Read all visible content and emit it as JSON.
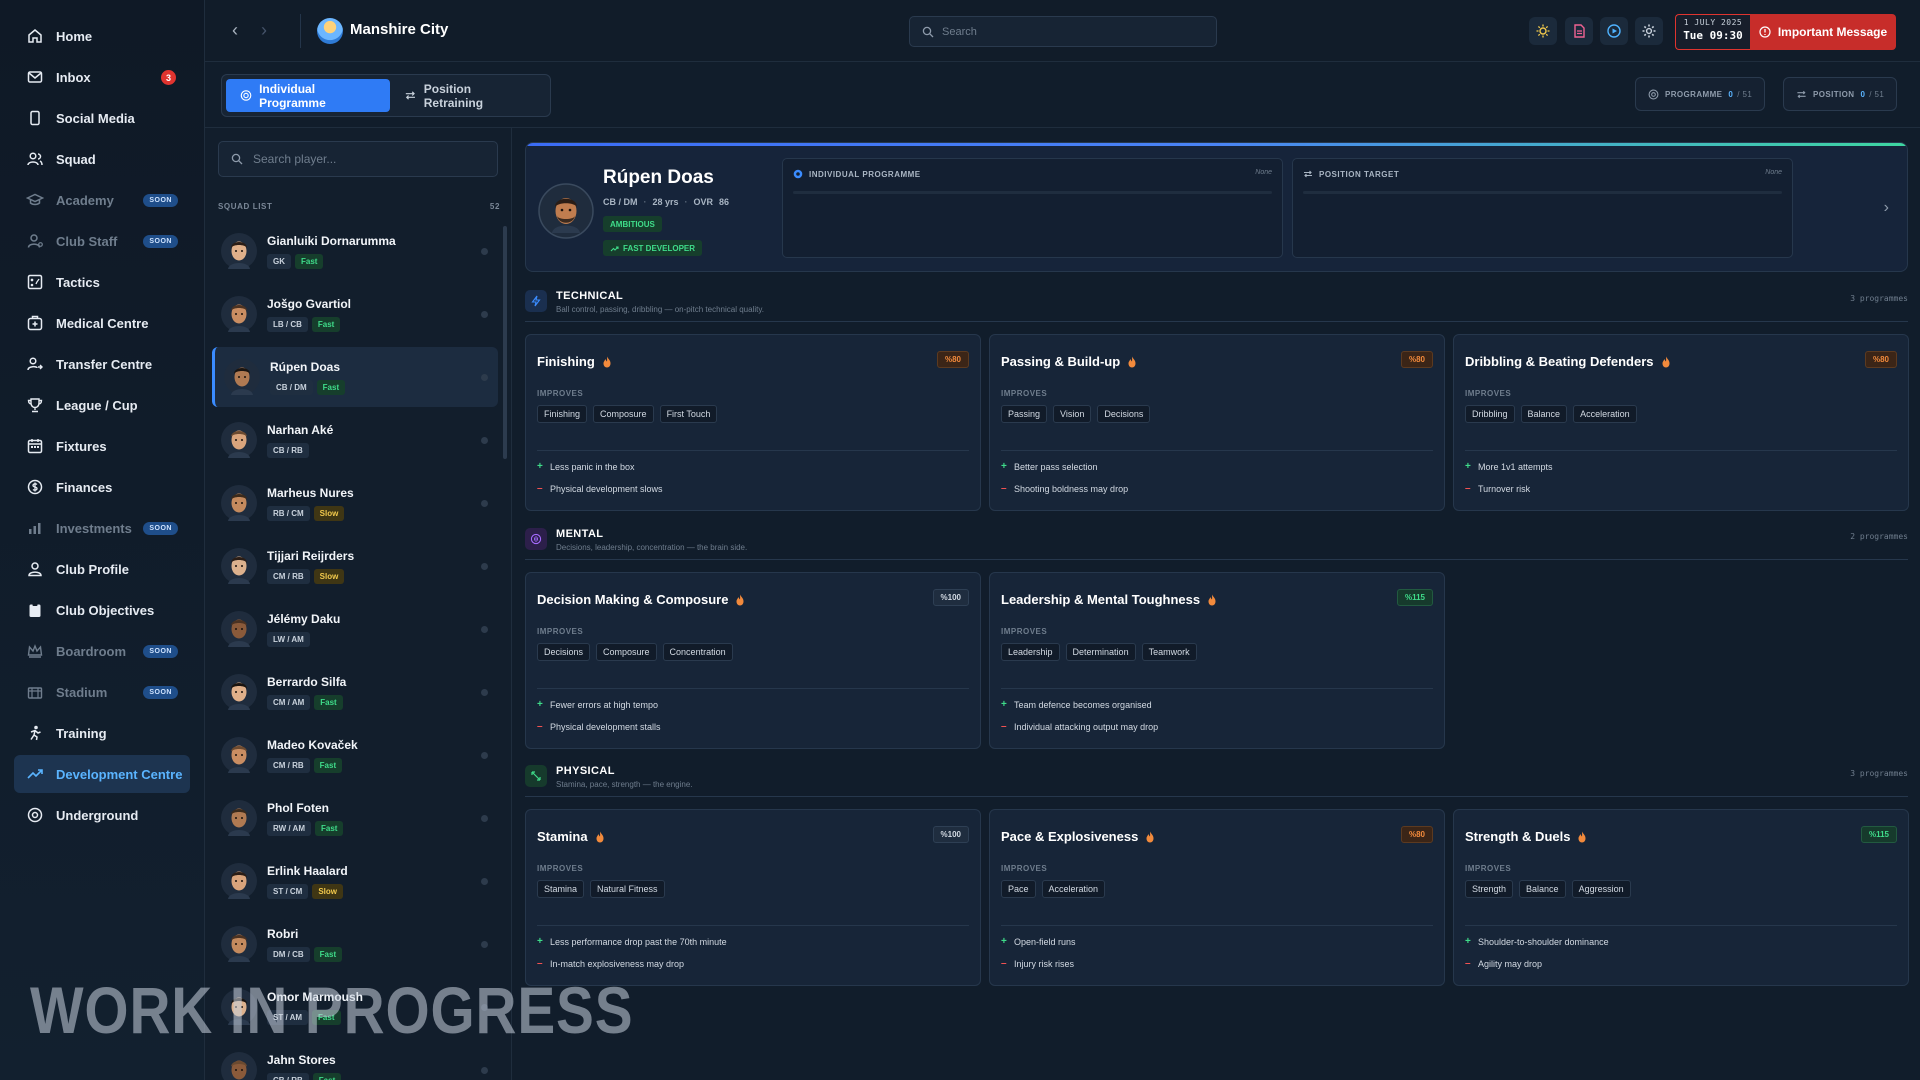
{
  "nav": [
    {
      "label": "Home",
      "icon": "home-icon"
    },
    {
      "label": "Inbox",
      "icon": "mail-icon",
      "badge": "3"
    },
    {
      "label": "Social Media",
      "icon": "phone-icon"
    },
    {
      "label": "Squad",
      "icon": "users-icon"
    },
    {
      "label": "Academy",
      "icon": "graduation-cap-icon",
      "soon": "SOON",
      "dim": true
    },
    {
      "label": "Club Staff",
      "icon": "staff-icon",
      "soon": "SOON",
      "dim": true
    },
    {
      "label": "Tactics",
      "icon": "tactics-board-icon"
    },
    {
      "label": "Medical Centre",
      "icon": "medical-icon"
    },
    {
      "label": "Transfer Centre",
      "icon": "transfer-icon"
    },
    {
      "label": "League / Cup",
      "icon": "trophy-icon"
    },
    {
      "label": "Fixtures",
      "icon": "calendar-icon"
    },
    {
      "label": "Finances",
      "icon": "coins-icon"
    },
    {
      "label": "Investments",
      "icon": "bar-chart-icon",
      "soon": "SOON",
      "dim": true
    },
    {
      "label": "Club Profile",
      "icon": "club-profile-icon"
    },
    {
      "label": "Club Objectives",
      "icon": "clipboard-icon"
    },
    {
      "label": "Boardroom",
      "icon": "crown-icon",
      "soon": "SOON",
      "dim": true
    },
    {
      "label": "Stadium",
      "icon": "stadium-icon",
      "soon": "SOON",
      "dim": true
    },
    {
      "label": "Training",
      "icon": "training-icon"
    },
    {
      "label": "Development Centre",
      "icon": "trend-up-icon",
      "active": true
    },
    {
      "label": "Underground",
      "icon": "underground-icon"
    }
  ],
  "topbar": {
    "club_name": "Manshire City",
    "search_placeholder": "Search",
    "date_line1": "1 JULY 2025",
    "date_line2": "Tue 09:30",
    "important_label": "Important Message",
    "icons": [
      "sun-icon",
      "document-icon",
      "play-icon",
      "gear-icon"
    ]
  },
  "subheader": {
    "tab_individual": "Individual Programme",
    "tab_position": "Position Retraining",
    "programme_label": "PROGRAMME",
    "programme_value": "0",
    "programme_total": "/ 51",
    "position_label": "POSITION",
    "position_value": "0",
    "position_total": "/ 51"
  },
  "squad": {
    "search_placeholder": "Search player...",
    "list_title": "SQUAD LIST",
    "list_count": "52",
    "players": [
      {
        "name": "Gianluiki Dornarumma",
        "pos": "GK",
        "pace": "Fast"
      },
      {
        "name": "Jošgo Gvartiol",
        "pos": "LB / CB",
        "pace": "Fast"
      },
      {
        "name": "Rúpen Doas",
        "pos": "CB / DM",
        "pace": "Fast",
        "selected": true
      },
      {
        "name": "Narhan Aké",
        "pos": "CB / RB",
        "pace": ""
      },
      {
        "name": "Marheus Nures",
        "pos": "RB / CM",
        "pace": "Slow"
      },
      {
        "name": "Tijjari Reijrders",
        "pos": "CM / RB",
        "pace": "Slow"
      },
      {
        "name": "Jélémy Daku",
        "pos": "LW / AM",
        "pace": ""
      },
      {
        "name": "Berrardo Silfa",
        "pos": "CM / AM",
        "pace": "Fast"
      },
      {
        "name": "Madeo Kovaček",
        "pos": "CM / RB",
        "pace": "Fast"
      },
      {
        "name": "Phol Foten",
        "pos": "RW / AM",
        "pace": "Fast"
      },
      {
        "name": "Erlink Haalard",
        "pos": "ST / CM",
        "pace": "Slow"
      },
      {
        "name": "Robri",
        "pos": "DM / CB",
        "pace": "Fast"
      },
      {
        "name": "Omor Marmoush",
        "pos": "ST / AM",
        "pace": "Fast"
      },
      {
        "name": "Jahn Stores",
        "pos": "CB / RB",
        "pace": "Fast"
      }
    ]
  },
  "hero": {
    "name": "Rúpen Doas",
    "positions": "CB / DM",
    "age": "28 yrs",
    "ovr_label": "OVR",
    "ovr_value": "86",
    "trait1": "AMBITIOUS",
    "trait2": "FAST DEVELOPER",
    "slot1_title": "INDIVIDUAL PROGRAMME",
    "slot1_value": "None",
    "slot2_title": "POSITION TARGET",
    "slot2_value": "None"
  },
  "sections": {
    "technical": {
      "title": "TECHNICAL",
      "subtitle": "Ball control, passing, dribbling — on-pitch technical quality.",
      "count": "3 programmes",
      "color": "#3b8cff"
    },
    "mental": {
      "title": "MENTAL",
      "subtitle": "Decisions, leadership, concentration — the brain side.",
      "count": "2 programmes",
      "color": "#a66bff"
    },
    "physical": {
      "title": "PHYSICAL",
      "subtitle": "Stamina, pace, strength — the engine.",
      "count": "3 programmes",
      "color": "#3fdc8a"
    }
  },
  "cards": {
    "finishing": {
      "title": "Finishing",
      "badge": "%80",
      "improves": "IMPROVES",
      "chips": [
        "Finishing",
        "Composure",
        "First Touch"
      ],
      "pro": "Less panic in the box",
      "con": "Physical development slows"
    },
    "passing": {
      "title": "Passing & Build-up",
      "badge": "%80",
      "improves": "IMPROVES",
      "chips": [
        "Passing",
        "Vision",
        "Decisions"
      ],
      "pro": "Better pass selection",
      "con": "Shooting boldness may drop"
    },
    "dribbling": {
      "title": "Dribbling & Beating Defenders",
      "badge": "%80",
      "improves": "IMPROVES",
      "chips": [
        "Dribbling",
        "Balance",
        "Acceleration"
      ],
      "pro": "More 1v1 attempts",
      "con": "Turnover risk"
    },
    "decision": {
      "title": "Decision Making & Composure",
      "badge": "%100",
      "improves": "IMPROVES",
      "chips": [
        "Decisions",
        "Composure",
        "Concentration"
      ],
      "pro": "Fewer errors at high tempo",
      "con": "Physical development stalls"
    },
    "leadership": {
      "title": "Leadership & Mental Toughness",
      "badge": "%115",
      "improves": "IMPROVES",
      "chips": [
        "Leadership",
        "Determination",
        "Teamwork"
      ],
      "pro": "Team defence becomes organised",
      "con": "Individual attacking output may drop"
    },
    "stamina": {
      "title": "Stamina",
      "badge": "%100",
      "improves": "IMPROVES",
      "chips": [
        "Stamina",
        "Natural Fitness"
      ],
      "pro": "Less performance drop past the 70th minute",
      "con": "In-match explosiveness may drop"
    },
    "pace": {
      "title": "Pace & Explosiveness",
      "badge": "%80",
      "improves": "IMPROVES",
      "chips": [
        "Pace",
        "Acceleration"
      ],
      "pro": "Open-field runs",
      "con": "Injury risk rises"
    },
    "strength": {
      "title": "Strength & Duels",
      "badge": "%115",
      "improves": "IMPROVES",
      "chips": [
        "Strength",
        "Balance",
        "Aggression"
      ],
      "pro": "Shoulder-to-shoulder dominance",
      "con": "Agility may drop"
    }
  },
  "watermark": "WORK IN PROGRESS",
  "colors": {
    "accent": "#2f7bf5",
    "danger": "#c72d2a",
    "positive": "#3fdc8a",
    "warning": "#f28a3c"
  }
}
